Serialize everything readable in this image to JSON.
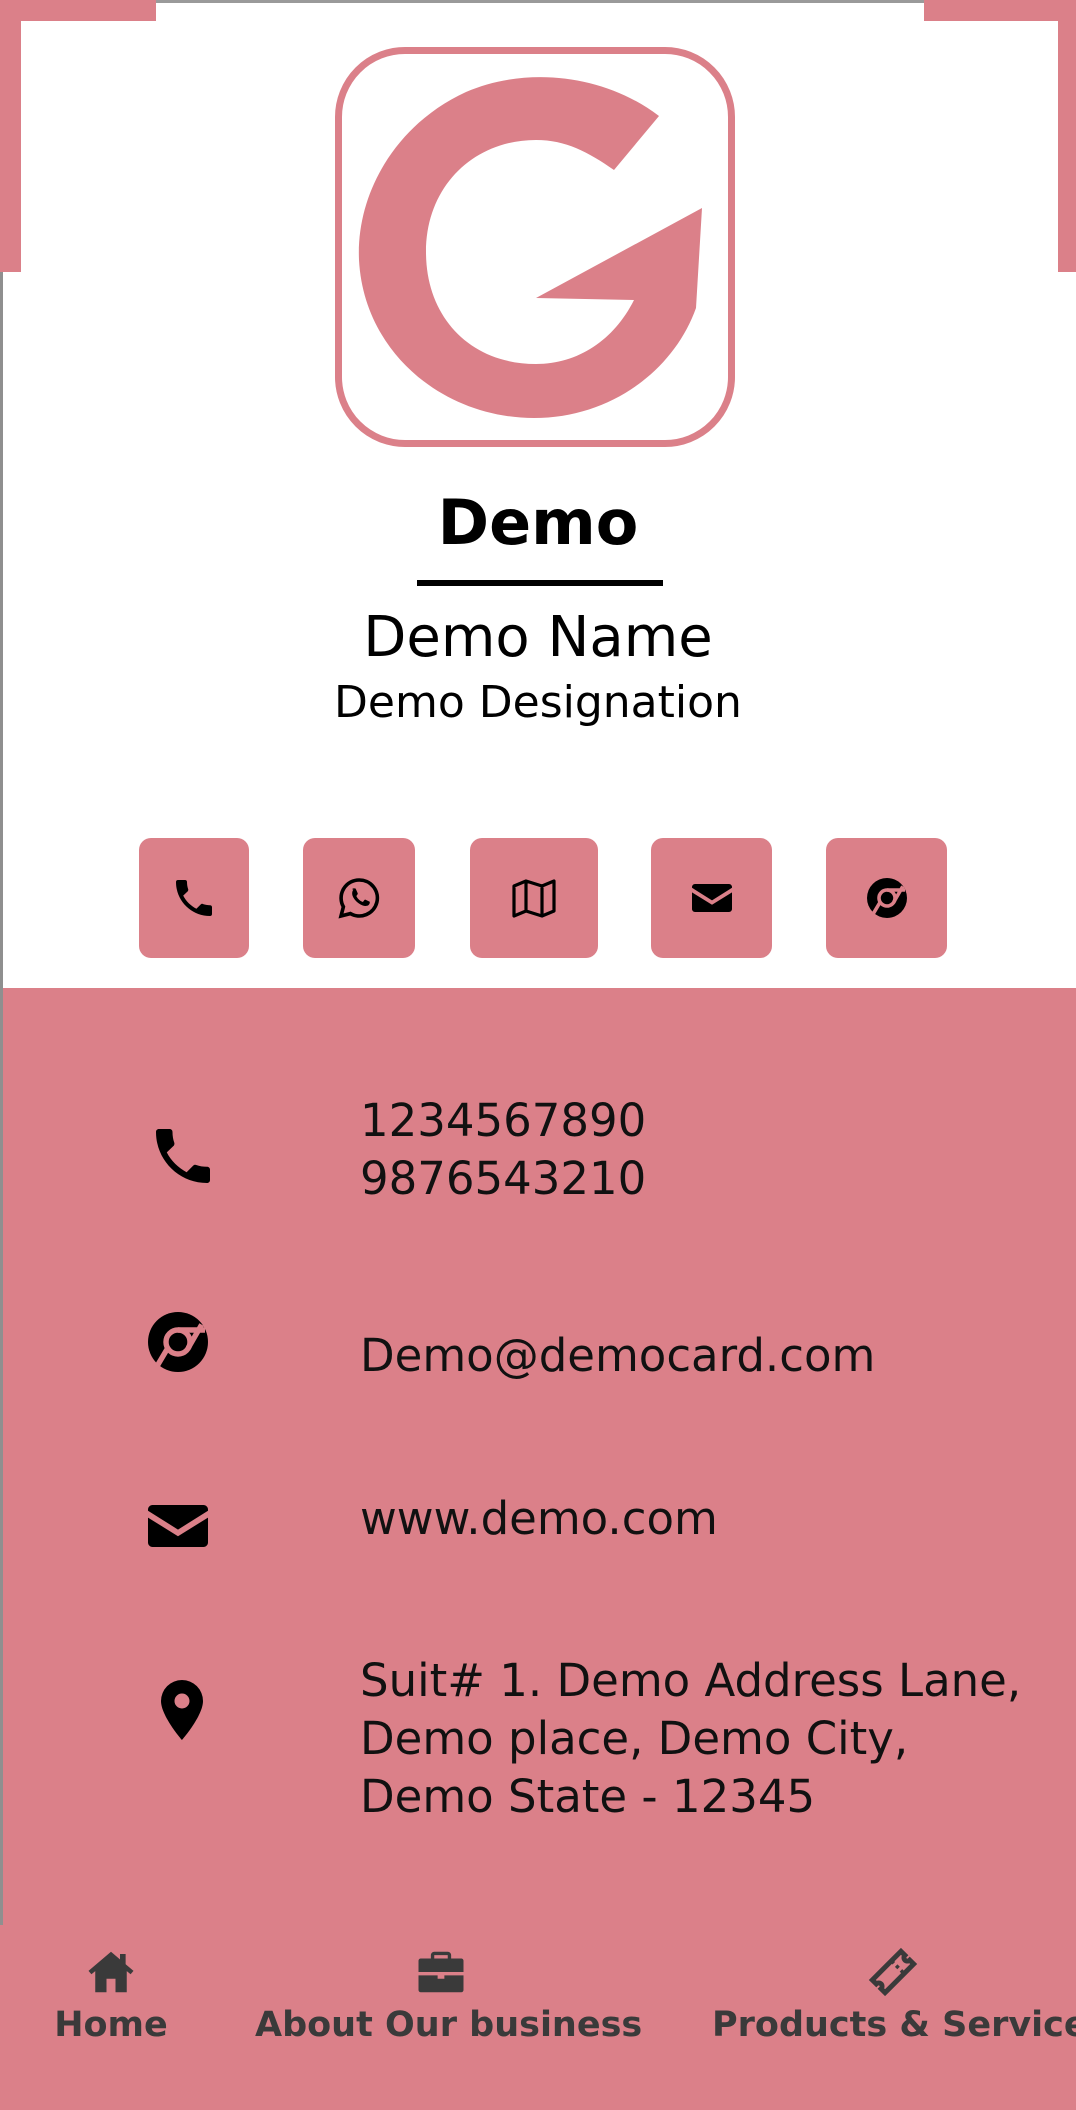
{
  "theme": {
    "accent": "#db8089",
    "icon_color": "#000000",
    "nav_text": "#3a3a3a"
  },
  "header": {
    "logo_icon": "g-logo-icon",
    "company": "Demo",
    "name": "Demo Name",
    "designation": "Demo Designation"
  },
  "actions": [
    {
      "icon": "phone-icon",
      "label": "Call"
    },
    {
      "icon": "whatsapp-icon",
      "label": "WhatsApp"
    },
    {
      "icon": "map-icon",
      "label": "Map"
    },
    {
      "icon": "envelope-icon",
      "label": "Email"
    },
    {
      "icon": "chrome-icon",
      "label": "Website"
    }
  ],
  "contact": {
    "phones": [
      "1234567890",
      "9876543210"
    ],
    "email_row": {
      "icon": "chrome-icon",
      "text": "Demo@democard.com"
    },
    "website_row": {
      "icon": "envelope-icon",
      "text": "www.demo.com"
    },
    "address_lines": [
      "Suit# 1. Demo Address Lane,",
      "Demo place, Demo City,",
      "Demo State - 12345"
    ]
  },
  "nav": {
    "home": {
      "icon": "home-icon",
      "label": "Home"
    },
    "about": {
      "icon": "briefcase-icon",
      "label": "About Our business"
    },
    "products": {
      "icon": "ticket-icon",
      "label": "Products & Services"
    }
  }
}
